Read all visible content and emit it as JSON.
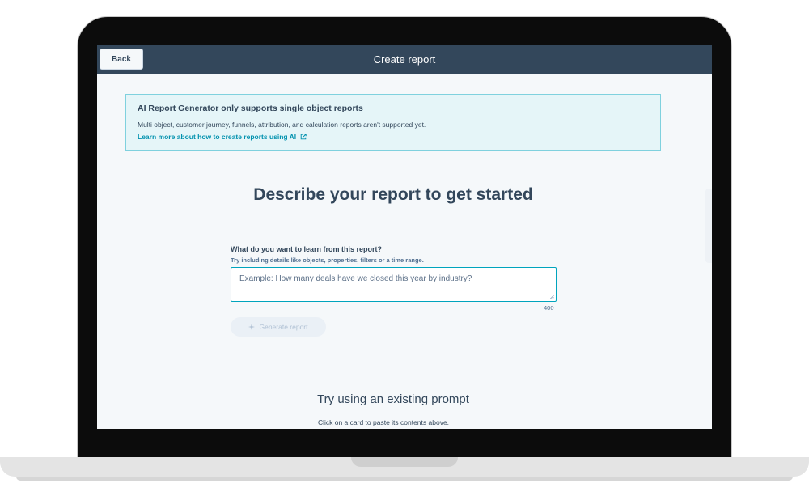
{
  "header": {
    "back_label": "Back",
    "title": "Create report"
  },
  "alert": {
    "title": "AI Report Generator only supports single object reports",
    "body": "Multi object, customer journey, funnels, attribution, and calculation reports aren't supported yet.",
    "link": "Learn more about how to create reports using AI"
  },
  "main": {
    "heading": "Describe your report to get started",
    "question_label": "What do you want to learn from this report?",
    "question_help": "Try including details like objects, properties, filters or a time range.",
    "prompt_value": "",
    "prompt_placeholder": "Example: How many deals have we closed this year by industry?",
    "char_counter": "400",
    "generate_label": "Generate report"
  },
  "prompts": {
    "title": "Try using an existing prompt",
    "subtitle": "Click on a card to paste its contents above."
  },
  "colors": {
    "topbar": "#33475b",
    "accent": "#00a4bd",
    "link": "#0091ae",
    "alert_bg": "#e5f5f8"
  },
  "icons": {
    "external_link": "external-link-icon",
    "sparkle": "sparkle-icon"
  }
}
